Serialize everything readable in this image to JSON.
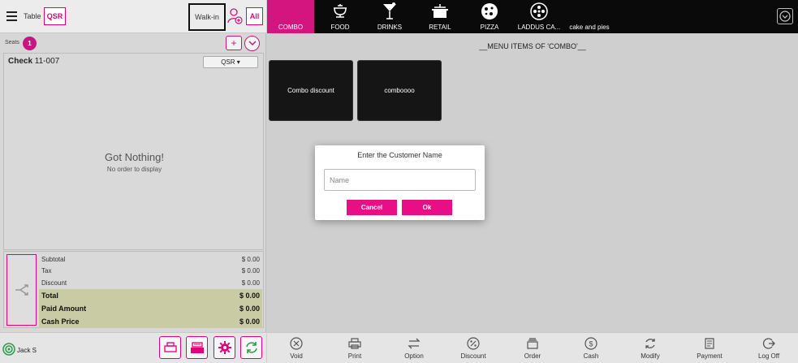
{
  "topbar": {
    "table_label": "Table",
    "qsr_button": "QSR",
    "walkin_button": "Walk-in",
    "all_button": "All"
  },
  "seats": {
    "label": "Seats",
    "count": "1"
  },
  "check": {
    "label": "Check",
    "number": "11-007",
    "order_type": "QSR ▾",
    "empty_title": "Got Nothing!",
    "empty_sub": "No order to display"
  },
  "totals": {
    "subtotal_label": "Subtotal",
    "subtotal": "$ 0.00",
    "tax_label": "Tax",
    "tax": "$ 0.00",
    "discount_label": "Discount",
    "discount": "$ 0.00",
    "total_label": "Total",
    "total": "$ 0.00",
    "paid_label": "Paid Amount",
    "paid": "$ 0.00",
    "cash_label": "Cash Price",
    "cash": "$ 0.00"
  },
  "user": {
    "name": "Jack S"
  },
  "categories": [
    {
      "label": "COMBO",
      "icon": "none",
      "active": true
    },
    {
      "label": "FOOD",
      "icon": "food-dish-icon"
    },
    {
      "label": "DRINKS",
      "icon": "cocktail-icon"
    },
    {
      "label": "RETAIL",
      "icon": "pot-icon"
    },
    {
      "label": "PIZZA",
      "icon": "pizza-icon"
    },
    {
      "label": "LADDUS CA...",
      "icon": "laddu-icon"
    },
    {
      "label": "cake and pies",
      "icon": "none"
    }
  ],
  "menu": {
    "title": "__MENU ITEMS OF 'COMBO'__",
    "items": [
      "Combo discount",
      "comboooo"
    ]
  },
  "modal": {
    "title": "Enter the Customer Name",
    "placeholder": "Name",
    "cancel": "Cancel",
    "ok": "Ok"
  },
  "actions": [
    "Void",
    "Print",
    "Option",
    "Discount",
    "Order",
    "Cash",
    "Modify",
    "Payment",
    "Log Off"
  ],
  "colors": {
    "accent": "#e0007a",
    "category_bar": "#0a0a0a",
    "active_category": "#d4147f",
    "totals_highlight": "#c8cba3"
  }
}
